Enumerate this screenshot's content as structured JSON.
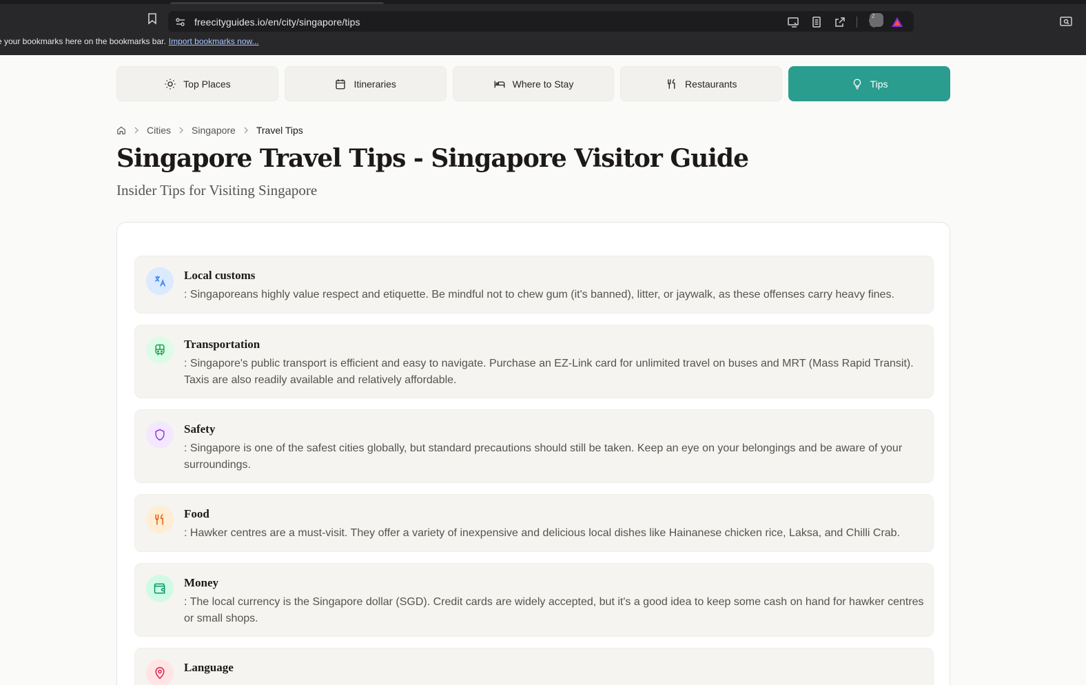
{
  "browser": {
    "url": "freecityguides.io/en/city/singapore/tips",
    "brave_badge": "2",
    "bookmarks_bar_text": "e your bookmarks here on the bookmarks bar.",
    "bookmarks_import_link": "Import bookmarks now..."
  },
  "nav": {
    "tabs": [
      {
        "label": "Top Places",
        "icon": "sun-icon"
      },
      {
        "label": "Itineraries",
        "icon": "calendar-icon"
      },
      {
        "label": "Where to Stay",
        "icon": "bed-icon"
      },
      {
        "label": "Restaurants",
        "icon": "utensils-icon"
      },
      {
        "label": "Tips",
        "icon": "lightbulb-icon",
        "active": true
      }
    ]
  },
  "breadcrumb": {
    "items": [
      "Cities",
      "Singapore",
      "Travel Tips"
    ]
  },
  "page": {
    "title": "Singapore Travel Tips - Singapore Visitor Guide",
    "subtitle": "Insider Tips for Visiting Singapore"
  },
  "tips": [
    {
      "title": "Local customs",
      "text": ": Singaporeans highly value respect and etiquette. Be mindful not to chew gum (it's banned), litter, or jaywalk, as these offenses carry heavy fines.",
      "icon": "translate-icon",
      "icon_color": "#3b82f6",
      "icon_bg": "#dbeafe"
    },
    {
      "title": "Transportation",
      "text": ": Singapore's public transport is efficient and easy to navigate. Purchase an EZ-Link card for unlimited travel on buses and MRT (Mass Rapid Transit). Taxis are also readily available and relatively affordable.",
      "icon": "train-icon",
      "icon_color": "#16a34a",
      "icon_bg": "#dcfce7"
    },
    {
      "title": "Safety",
      "text": ": Singapore is one of the safest cities globally, but standard precautions should still be taken. Keep an eye on your belongings and be aware of your surroundings.",
      "icon": "shield-icon",
      "icon_color": "#9333ea",
      "icon_bg": "#f3e8ff"
    },
    {
      "title": "Food",
      "text": ": Hawker centres are a must-visit. They offer a variety of inexpensive and delicious local dishes like Hainanese chicken rice, Laksa, and Chilli Crab.",
      "icon": "utensils-icon",
      "icon_color": "#ea580c",
      "icon_bg": "#ffedd5"
    },
    {
      "title": "Money",
      "text": ": The local currency is the Singapore dollar (SGD). Credit cards are widely accepted, but it's a good idea to keep some cash on hand for hawker centres or small shops.",
      "icon": "wallet-icon",
      "icon_color": "#059669",
      "icon_bg": "#d1fae5"
    },
    {
      "title": "Language",
      "text": "",
      "icon": "map-pin-icon",
      "icon_color": "#e11d48",
      "icon_bg": "#ffe4e6"
    }
  ],
  "colors": {
    "accent": "#2a9d8f",
    "chrome": "#28282b"
  }
}
